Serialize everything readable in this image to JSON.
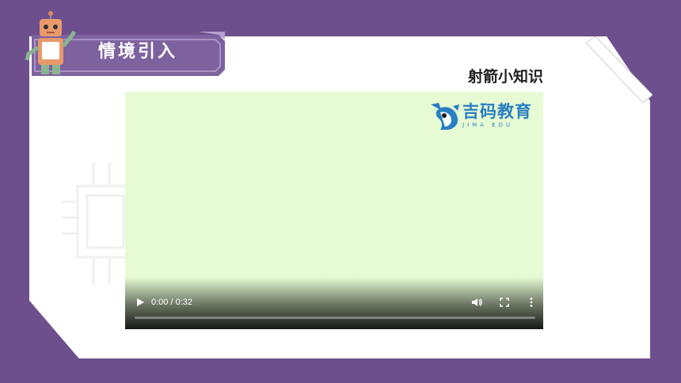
{
  "header": {
    "title": "情境引入"
  },
  "content": {
    "subtitle": "射箭小知识"
  },
  "video": {
    "time_display": "0:00 / 0:32",
    "progress": 0,
    "background_color": "#e6fbd4",
    "logo": {
      "name": "吉码教育",
      "subtext": "JIMA EDU"
    }
  },
  "icons": {
    "play": "play-icon",
    "volume": "volume-icon",
    "fullscreen": "fullscreen-icon",
    "more": "more-vertical-icon"
  },
  "colors": {
    "frame": "#6d4f8e",
    "banner": "#7e629f",
    "logo_blue": "#2a7fc2"
  }
}
